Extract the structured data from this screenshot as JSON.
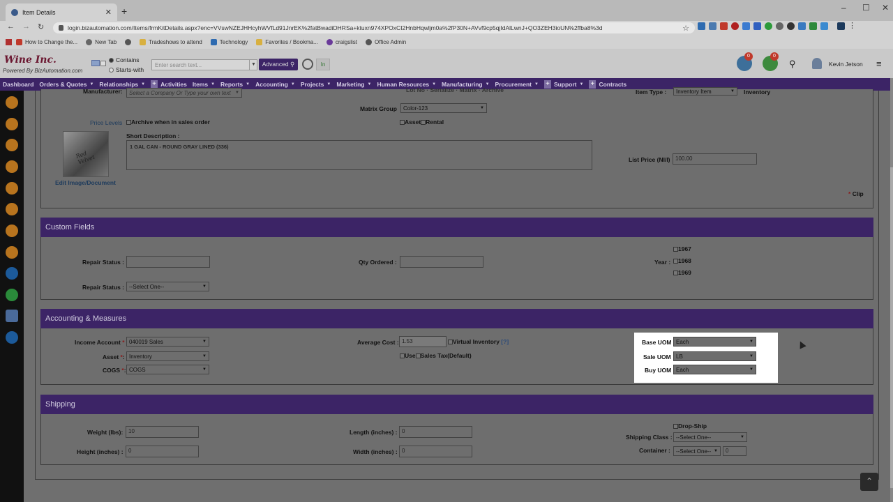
{
  "browser": {
    "tab_title": "Item Details",
    "url": "login.bizautomation.com/Items/frmKitDetails.aspx?enc=VVswNZEJHHcyhWVfLd91JnrEK%2fatBwadiDHRSa+ktuxn974XPOxCI2HnbHqwljm0a%2fP30N+AVvf9cp5qjIdAlLwnJ+QO3ZEH3ioUN%2ffba8%3d",
    "bookmarks": [
      "How to Change the...",
      "New Tab",
      "Tradeshows to attend",
      "Technology",
      "Favorites / Bookma...",
      "craigslist",
      "Office Admin"
    ]
  },
  "header": {
    "logo": "Wine Inc.",
    "powered_by": "Powered By BizAutomation.com",
    "radio_contains": "Contains",
    "radio_starts_with": "Starts-with",
    "search_placeholder": "Enter search text...",
    "advanced_label": "Advanced",
    "in_label": "In",
    "inbox_badge": "0",
    "cart_badge": "0",
    "user_name": "Kevin Jetson"
  },
  "nav": [
    "Dashboard",
    "Orders & Quotes",
    "Relationships",
    "Activities",
    "Items",
    "Reports",
    "Accounting",
    "Projects",
    "Marketing",
    "Human Resources",
    "Manufacturing",
    "Procurement",
    "Support",
    "Contracts"
  ],
  "top": {
    "manufacturer_label": "Manufacturer:",
    "manufacturer_value": "Select a Company Or Type your own text",
    "partial_labels": "Lot No · Serialize · Matrix · Archive",
    "item_type_label": "Item Type :",
    "item_type_value": "Inventory Item",
    "item_type_text": "Inventory",
    "matrix_group_label": "Matrix Group",
    "matrix_group_value": "Color-123",
    "price_levels": "Price Levels",
    "archive_label": "Archive when in sales order",
    "asset_label": "Asset",
    "rental_label": "Rental",
    "short_desc_label": "Short Description :",
    "short_desc_value": "1 GAL CAN - ROUND GRAY LINED (336)",
    "list_price_label": "List Price (NI/I)",
    "list_price_value": "100.00",
    "edit_image": "Edit Image/Document",
    "clip_star": "*",
    "clip_label": "Clip"
  },
  "custom_fields": {
    "title": "Custom Fields",
    "repair_status_label": "Repair Status :",
    "repair_status_label2": "Repair Status :",
    "repair_status_select": "--Select One--",
    "qty_ordered_label": "Qty Ordered :",
    "year_label": "Year :",
    "years": [
      "1967",
      "1968",
      "1969"
    ]
  },
  "accounting": {
    "title": "Accounting & Measures",
    "income_label": "Income Account",
    "income_value": "040019 Sales",
    "asset_label": "Asset",
    "asset_value": "Inventory",
    "cogs_label": "COGS",
    "cogs_value": "COGS",
    "avg_cost_label": "Average Cost :",
    "avg_cost_value": "1.53",
    "virtual_inventory": "Virtual Inventory",
    "help": "[?]",
    "use_label": "Use",
    "sales_tax_label": "Sales Tax(Default)",
    "base_uom_label": "Base UOM",
    "base_uom_value": "Each",
    "sale_uom_label": "Sale UOM",
    "sale_uom_value": "LB",
    "buy_uom_label": "Buy UOM",
    "buy_uom_value": "Each",
    "required": "*"
  },
  "shipping": {
    "title": "Shipping",
    "weight_label": "Weight (lbs):",
    "weight_value": "10",
    "height_label": "Height (inches) :",
    "height_value": "0",
    "length_label": "Length (inches) :",
    "length_value": "0",
    "width_label": "Width (inches) :",
    "width_value": "0",
    "drop_ship": "Drop-Ship",
    "shipping_class_label": "Shipping Class :",
    "shipping_class_value": "--Select One--",
    "container_label": "Container :",
    "container_value": "--Select One--",
    "container_qty": "0"
  },
  "colors": {
    "brand_purple": "#3c2466",
    "required_red": "#c0392b"
  }
}
